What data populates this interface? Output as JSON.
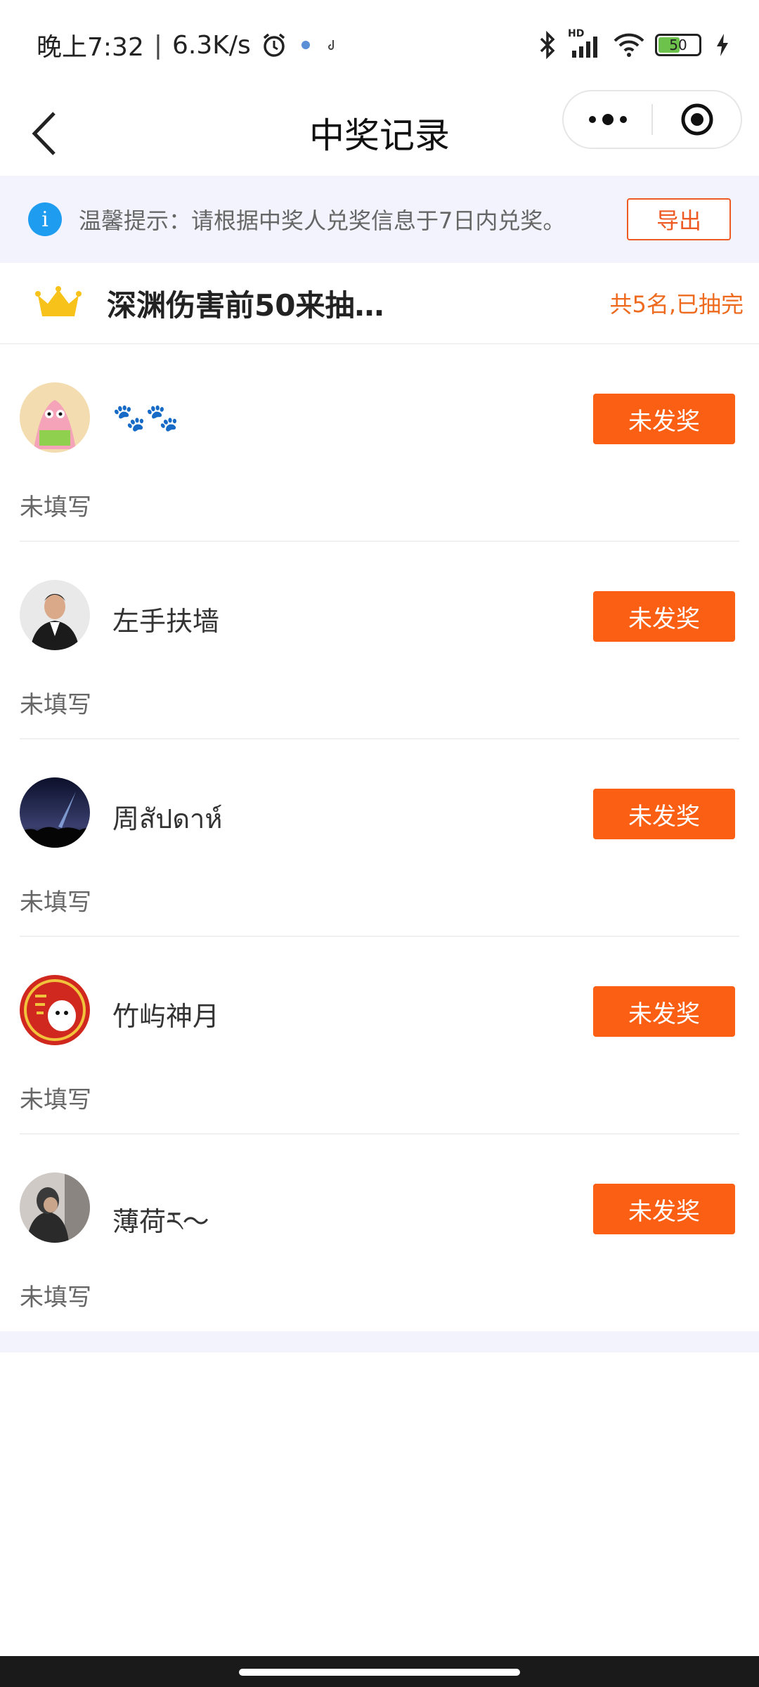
{
  "status_bar": {
    "time": "晚上7:32",
    "network_speed": "6.3K/s",
    "separator": "|",
    "battery_level": "50",
    "icons": [
      "alarm-icon",
      "notification-icon",
      "tiktok-icon",
      "bluetooth-icon",
      "signal-icon",
      "wifi-icon",
      "battery-icon",
      "charging-icon"
    ],
    "signal_label": "HD"
  },
  "nav": {
    "title": "中奖记录",
    "back_icon": "chevron-left-icon",
    "more_icon": "more-dots-icon",
    "close_icon": "target-icon"
  },
  "tip": {
    "icon": "info-icon",
    "icon_glyph": "i",
    "text": "温馨提示：请根据中奖人兑奖信息于7日内兑奖。",
    "export_label": "导出"
  },
  "prize": {
    "icon": "crown-icon",
    "title": "深渊伤害前50来抽…",
    "count_text": "共5名,已抽完"
  },
  "winners": [
    {
      "name": "🐾🐾",
      "status": "未发奖",
      "info": "未填写",
      "avatar": "avatar-patrick"
    },
    {
      "name": "左手扶墙",
      "status": "未发奖",
      "info": "未填写",
      "avatar": "avatar-man-suit"
    },
    {
      "name": "周สัปดาห์",
      "status": "未发奖",
      "info": "未填写",
      "avatar": "avatar-night-sky"
    },
    {
      "name": "竹屿神月",
      "status": "未发奖",
      "info": "未填写",
      "avatar": "avatar-red-cartoon"
    },
    {
      "name": "薄荷ར〜",
      "status": "未发奖",
      "info": "未填写",
      "avatar": "avatar-person"
    }
  ],
  "colors": {
    "accent_orange": "#fb5f14",
    "tip_background": "#f3f3fd",
    "info_blue": "#1e9cf0",
    "crown_gold": "#f7c21a"
  }
}
